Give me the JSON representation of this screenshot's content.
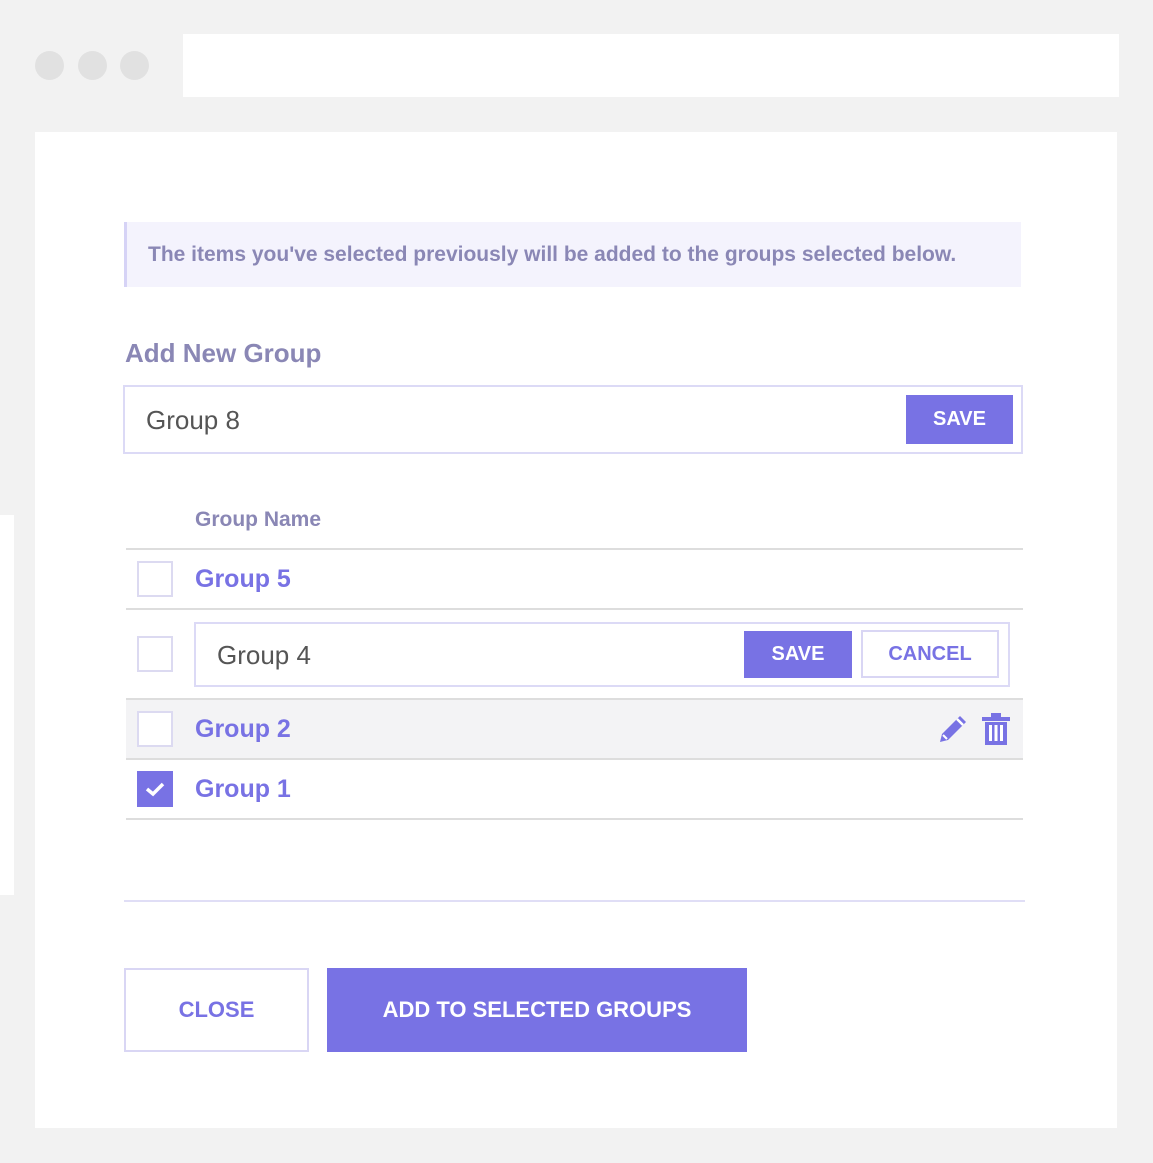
{
  "colors": {
    "accent": "#7872e4",
    "muted_text": "#8a87b5",
    "notice_bg": "#f4f3fd"
  },
  "notice": {
    "text": "The items you've selected previously will be added to the groups selected below."
  },
  "add_group": {
    "title": "Add New Group",
    "input_value": "Group 8",
    "save_label": "SAVE"
  },
  "table": {
    "column_header": "Group Name",
    "rows": [
      {
        "label": "Group 5",
        "checked": false
      },
      {
        "label": "Group 4",
        "checked": false,
        "editing": true
      },
      {
        "label": "Group 2",
        "checked": false,
        "hovered": true
      },
      {
        "label": "Group 1",
        "checked": true
      }
    ]
  },
  "edit_row": {
    "input_value": "Group 4",
    "save_label": "SAVE",
    "cancel_label": "CANCEL"
  },
  "row_actions": {
    "edit_icon": "pencil-icon",
    "delete_icon": "trash-icon"
  },
  "footer": {
    "close_label": "CLOSE",
    "submit_label": "ADD TO SELECTED GROUPS"
  }
}
